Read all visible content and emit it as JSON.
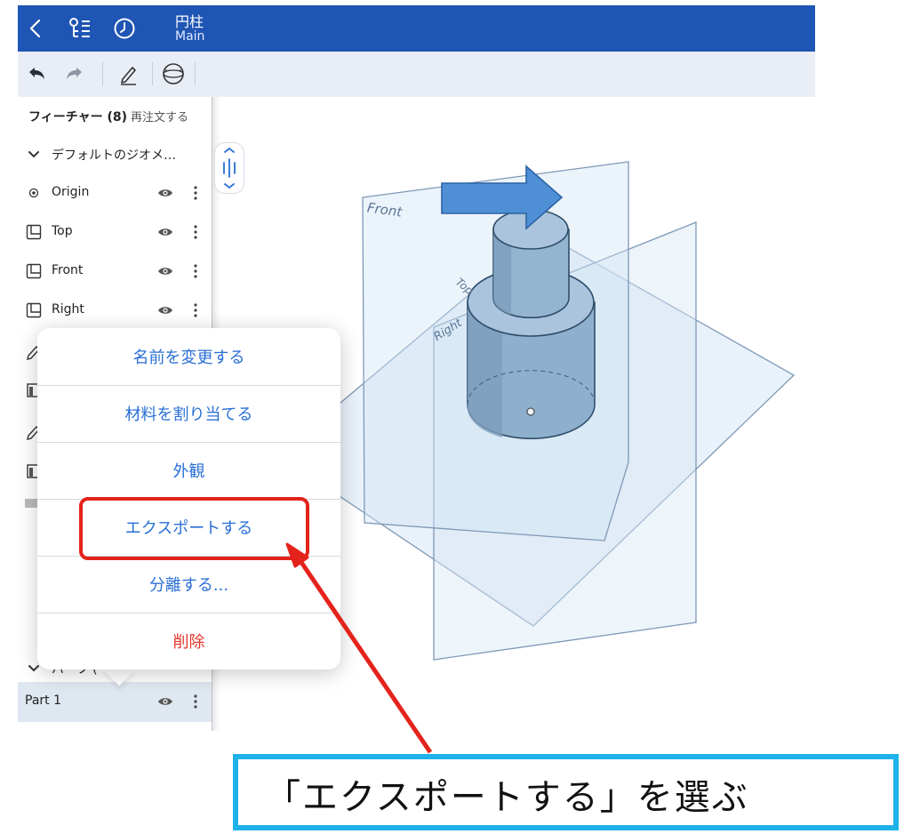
{
  "header": {
    "document_name": "円柱",
    "branch": "Main",
    "icons": [
      "back-chevron-icon",
      "feature-tree-icon",
      "history-clock-icon"
    ]
  },
  "toolbar": {
    "icons": [
      "undo-icon",
      "redo-icon",
      "sketch-pencil-icon",
      "view-cube-icon"
    ]
  },
  "feature_panel": {
    "title": "フィーチャー (8)",
    "reorder_label": "再注文する",
    "default_geometry_label": "デフォルトのジオメ…",
    "items": [
      {
        "label": "Origin",
        "icon": "origin-icon"
      },
      {
        "label": "Top",
        "icon": "plane-icon"
      },
      {
        "label": "Front",
        "icon": "plane-icon"
      },
      {
        "label": "Right",
        "icon": "plane-icon"
      }
    ],
    "parts_group_label": "パーツ (",
    "part_item": {
      "label": "Part 1"
    }
  },
  "viewport": {
    "plane_labels": {
      "front": "Front",
      "top": "Top",
      "right": "Right"
    }
  },
  "context_menu": {
    "items": [
      {
        "label": "名前を変更する",
        "color": "#2a6fd6"
      },
      {
        "label": "材料を割り当てる",
        "color": "#2a6fd6"
      },
      {
        "label": "外観",
        "color": "#2a6fd6"
      },
      {
        "label": "エクスポートする",
        "color": "#2a6fd6"
      },
      {
        "label": "分離する...",
        "color": "#2a6fd6"
      },
      {
        "label": "削除",
        "color": "#e2352d"
      }
    ]
  },
  "annotation": {
    "callout_text": "「エクスポートする」を選ぶ",
    "highlight_color": "#e3231c",
    "callout_border_color": "#1eb2ea"
  },
  "colors": {
    "header_bg": "#1f55b4",
    "toolbar_bg": "#e9eef6",
    "accent_blue": "#2a6fd6",
    "delete_red": "#e2352d"
  }
}
